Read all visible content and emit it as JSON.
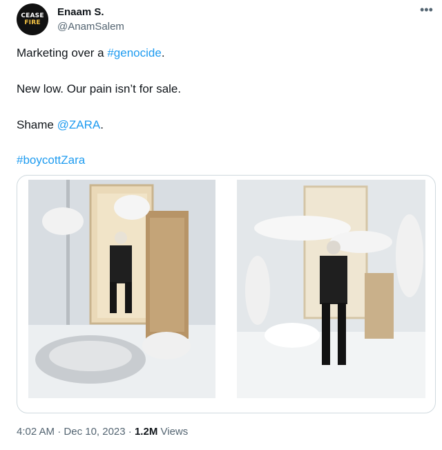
{
  "author": {
    "display_name": "Enaam S.",
    "handle": "@AnamSalem",
    "avatar_text_top": "CEASE",
    "avatar_text_bottom": "FIRE"
  },
  "more_icon": "•••",
  "tweet": {
    "line1_text": "Marketing over a ",
    "line1_hashtag": "#genocide",
    "line1_end": ".",
    "line2_text": "New low. Our pain isn’t for sale.",
    "line3_text": "Shame ",
    "line3_mention": "@ZARA",
    "line3_end": ".",
    "line4_hashtag": "#boycottZara"
  },
  "meta": {
    "time": "4:02 AM",
    "separator": "·",
    "date": "Dec 10, 2023",
    "views_count": "1.2M",
    "views_label": "Views"
  },
  "colors": {
    "link": "#1d9bf0",
    "secondary_text": "#536471",
    "primary_text": "#0f1419",
    "border": "#cfd9de"
  }
}
